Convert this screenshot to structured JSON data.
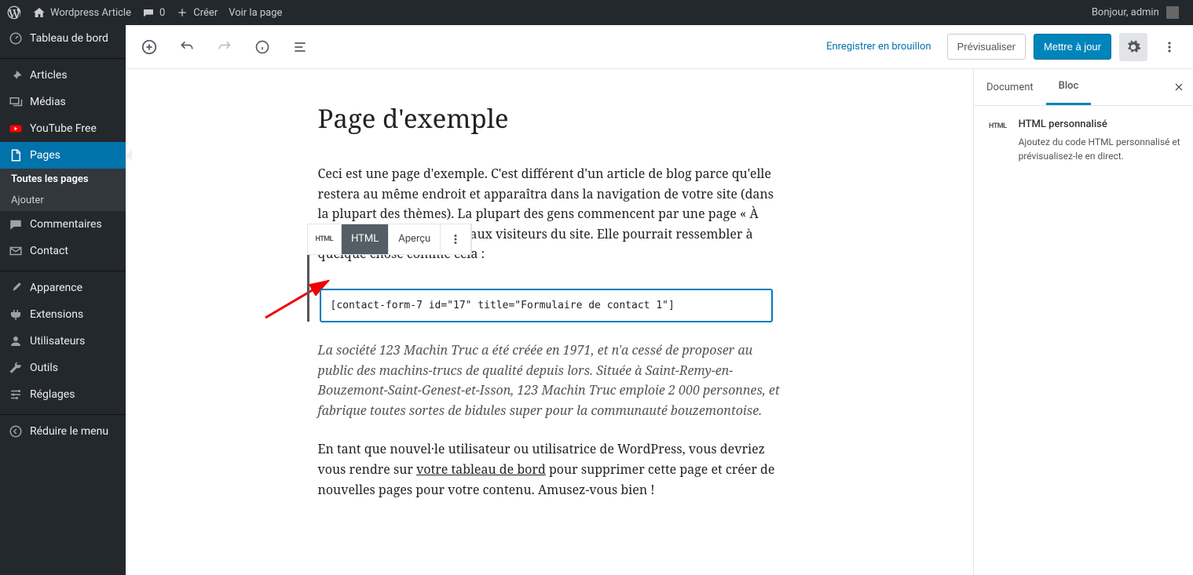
{
  "admin_bar": {
    "site_name": "Wordpress Article",
    "comments_count": "0",
    "create_label": "Créer",
    "view_page_label": "Voir la page",
    "greeting": "Bonjour, admin"
  },
  "sidebar": {
    "dashboard": "Tableau de bord",
    "articles": "Articles",
    "medias": "Médias",
    "youtube_free": "YouTube Free",
    "pages": "Pages",
    "pages_all": "Toutes les pages",
    "pages_add": "Ajouter",
    "comments": "Commentaires",
    "contact": "Contact",
    "appearance": "Apparence",
    "extensions": "Extensions",
    "users": "Utilisateurs",
    "tools": "Outils",
    "settings": "Réglages",
    "collapse": "Réduire le menu"
  },
  "editor_topbar": {
    "save_draft": "Enregistrer en brouillon",
    "preview": "Prévisualiser",
    "publish": "Mettre à jour"
  },
  "editor": {
    "title": "Page d'exemple",
    "para1": "Ceci est une page d'exemple. C'est différent d'un article de blog parce qu'elle restera au même endroit et apparaîtra dans la navigation de votre site (dans la plupart des thèmes). La plupart des gens commencent par une page « À propos » qui les présente aux visiteurs du site. Elle pourrait ressembler à quelque chose comme cela :",
    "block_toolbar": {
      "html_icon": "HTML",
      "html": "HTML",
      "preview": "Aperçu"
    },
    "html_block_value": "[contact-form-7 id=\"17\" title=\"Formulaire de contact 1\"]",
    "para2": "La société 123 Machin Truc a été créée en 1971, et n'a cessé de proposer au public des machins-trucs de qualité depuis lors. Située à Saint-Remy-en-Bouzemont-Saint-Genest-et-Isson, 123 Machin Truc emploie 2 000 personnes, et fabrique toutes sortes de bidules super pour la communauté bouzemontoise.",
    "para3_before": "En tant que nouvel·le utilisateur ou utilisatrice de WordPress, vous devriez vous rendre sur ",
    "para3_link": "votre tableau de bord",
    "para3_after": " pour supprimer cette page et créer de nouvelles pages pour votre contenu. Amusez-vous bien !"
  },
  "right_panel": {
    "tab_document": "Document",
    "tab_block": "Bloc",
    "block_icon": "HTML",
    "block_title": "HTML personnalisé",
    "block_desc": "Ajoutez du code HTML personnalisé et prévisualisez-le en direct."
  }
}
